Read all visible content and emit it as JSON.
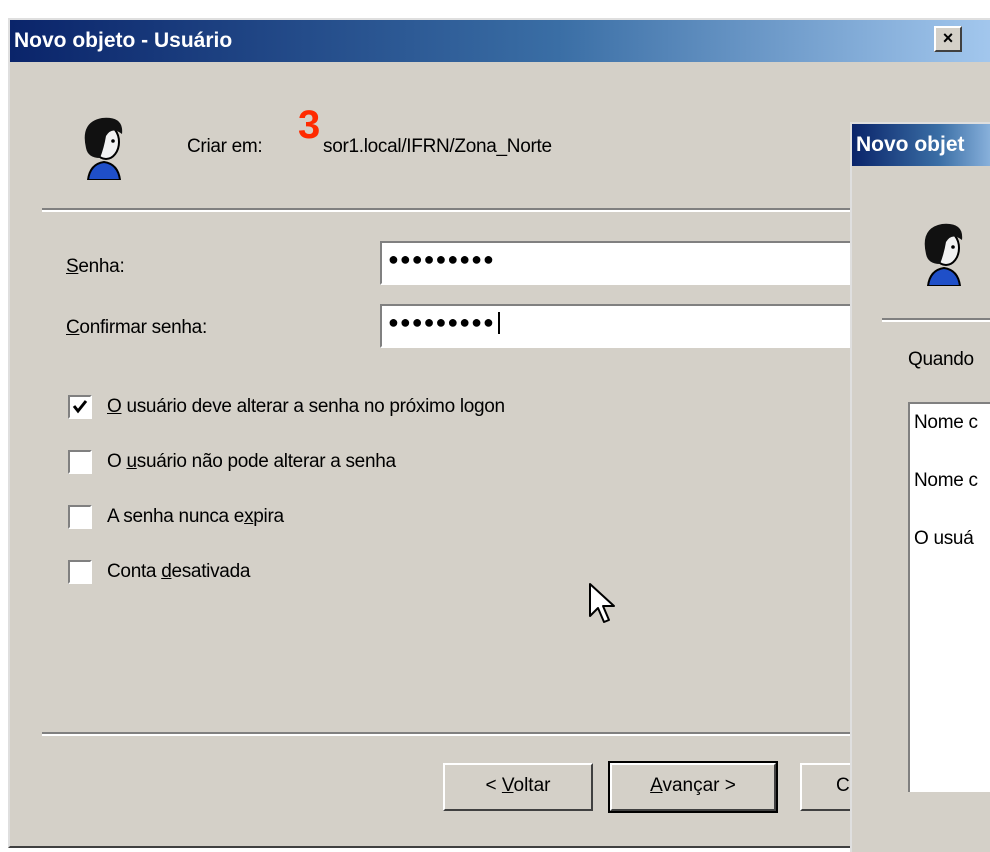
{
  "main_dialog": {
    "title": "Novo objeto - Usuário",
    "close_glyph": "×",
    "step_number": "3",
    "create_in_label": "Criar em:",
    "create_in_value": "sor1.local/IFRN/Zona_Norte",
    "password_label_accel": "S",
    "password_label_rest": "enha:",
    "password_value": "●●●●●●●●●",
    "confirm_label_accel": "C",
    "confirm_label_rest": "onfirmar senha:",
    "confirm_value": "●●●●●●●●●",
    "options": [
      {
        "pre": "",
        "accel": "O",
        "post": " usuário deve alterar a senha no próximo logon",
        "checked": true
      },
      {
        "pre": "O ",
        "accel": "u",
        "post": "suário não pode alterar a senha",
        "checked": false
      },
      {
        "pre": "A senha nunca e",
        "accel": "x",
        "post": "pira",
        "checked": false
      },
      {
        "pre": "Conta ",
        "accel": "d",
        "post": "esativada",
        "checked": false
      }
    ],
    "back_pre": "< ",
    "back_accel": "V",
    "back_post": "oltar",
    "next_accel": "A",
    "next_post": "vançar >",
    "cancel_partial": "C"
  },
  "second_dialog": {
    "title_partial": "Novo objet",
    "prompt_partial": "Quando",
    "list_items": [
      "Nome c",
      "Nome c",
      "O usuá"
    ]
  },
  "icons": {
    "user": "user-icon",
    "close": "close-icon",
    "cursor": "mouse-cursor-icon"
  },
  "colors": {
    "title_start": "#0a246a",
    "title_end": "#a6caf0",
    "dialog_bg": "#d4d0c8",
    "step": "#ff2a00"
  }
}
